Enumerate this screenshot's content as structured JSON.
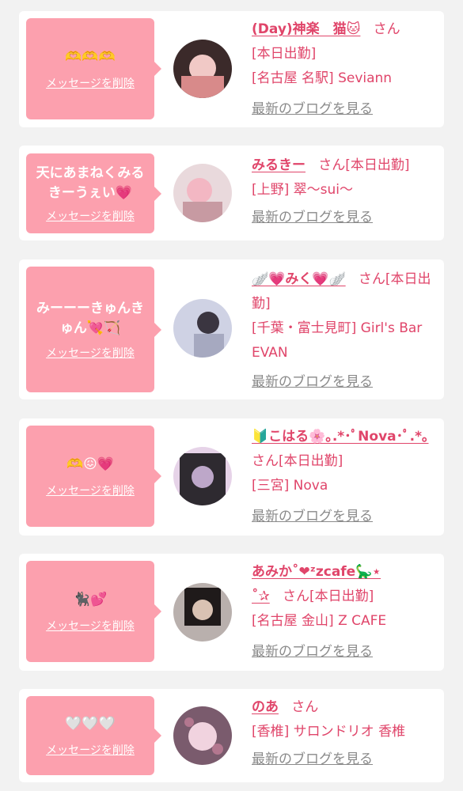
{
  "items": [
    {
      "message": "🫶🫶🫶",
      "delete_label": "メッセージを削除",
      "name": "(Day)神楽　猫🐱",
      "san": "さん",
      "status": "[本日出勤]",
      "shop": "[名古屋 名駅] Seviann",
      "blog_link": "最新のブログを見る",
      "avatar_colors": [
        "#3b2a2a",
        "#d88a8a",
        "#f1c9c6"
      ]
    },
    {
      "message": "天にあまねくみるきーうぇい💗",
      "delete_label": "メッセージを削除",
      "name": "みるきー",
      "san": "さん",
      "status": "[本日出勤]",
      "shop": "[上野] 翠〜sui〜",
      "blog_link": "最新のブログを見る",
      "avatar_colors": [
        "#e9d9dc",
        "#f3b7c3",
        "#c79aa2"
      ]
    },
    {
      "message": "みーーーきゅんきゅん💘🏹",
      "delete_label": "メッセージを削除",
      "name": "🪽💗みく💗🪽",
      "san": "さん",
      "status": "[本日出勤]",
      "shop": "[千葉・富士見町] Girl's Bar EVAN",
      "blog_link": "最新のブログを見る",
      "avatar_colors": [
        "#cfd2e4",
        "#3a3540",
        "#a6a9c0"
      ]
    },
    {
      "message": "🫶😖💗",
      "delete_label": "メッセージを削除",
      "name": "🔰こはる🌸｡.*･ﾟNova･ﾟ.*｡",
      "san": "さん",
      "status": "[本日出勤]",
      "shop": "[三宮] Nova",
      "blog_link": "最新のブログを見る",
      "avatar_colors": [
        "#2e2a30",
        "#bda7c9",
        "#e6d3e8"
      ]
    },
    {
      "message": "🐈‍⬛💕",
      "delete_label": "メッセージを削除",
      "name": "あみか˚❤︎ᶻzcafe🦕⋆",
      "name2": "˚✰",
      "san": "さん",
      "status": "[本日出勤]",
      "shop": "[名古屋 金山] Z CAFE",
      "blog_link": "最新のブログを見る",
      "avatar_colors": [
        "#1f1a1a",
        "#d9c2b3",
        "#b9b0ad"
      ]
    },
    {
      "message": "🤍🤍🤍",
      "delete_label": "メッセージを削除",
      "name": "のあ",
      "san": "さん",
      "status": "",
      "shop": "[香椎] サロンドリオ 香椎",
      "blog_link": "最新のブログを見る",
      "avatar_colors": [
        "#7a5b6d",
        "#f1d3df",
        "#b3778f"
      ]
    }
  ]
}
